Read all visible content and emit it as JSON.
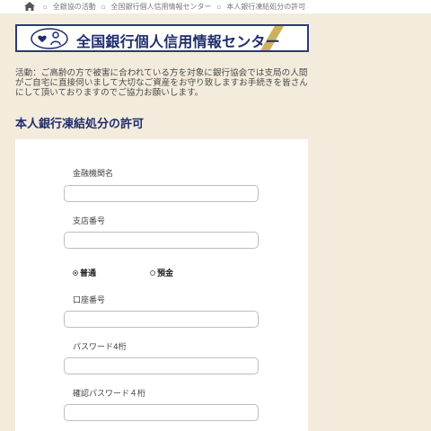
{
  "breadcrumb": {
    "items": [
      "全銀協の活動",
      "全国銀行個人信用情報センター",
      "本人銀行凍結処分の許可"
    ]
  },
  "banner": {
    "title": "全国銀行個人信用情報センター"
  },
  "notice": "活動：ご高齢の方で被害に合われている方を対象に銀行協会では支局の人間がご自宅に直接伺いまして大切なご資産をお守り致しますお手続きを皆さんにして頂いておりますのでご協力お願いします。",
  "section_heading": "本人銀行凍結処分の許可",
  "form": {
    "bank_name_label": "金融機関名",
    "bank_name_value": "",
    "branch_label": "支店番号",
    "branch_value": "",
    "account_type": {
      "options": [
        "普通",
        "預金"
      ],
      "selected": "普通"
    },
    "account_number_label": "口座番号",
    "account_number_value": "",
    "password_label": "パスワード4桁",
    "password_value": "",
    "confirm_password_label": "確認パスワード４桁",
    "confirm_password_value": ""
  },
  "icons": {
    "home": "home-icon",
    "separator": "square-bullet-icon",
    "logo": "heart-person-logo-icon"
  },
  "colors": {
    "page_background": "#f3ecdd",
    "brand_navy": "#1f2d6b",
    "accent_gold": "#c9a84a"
  }
}
